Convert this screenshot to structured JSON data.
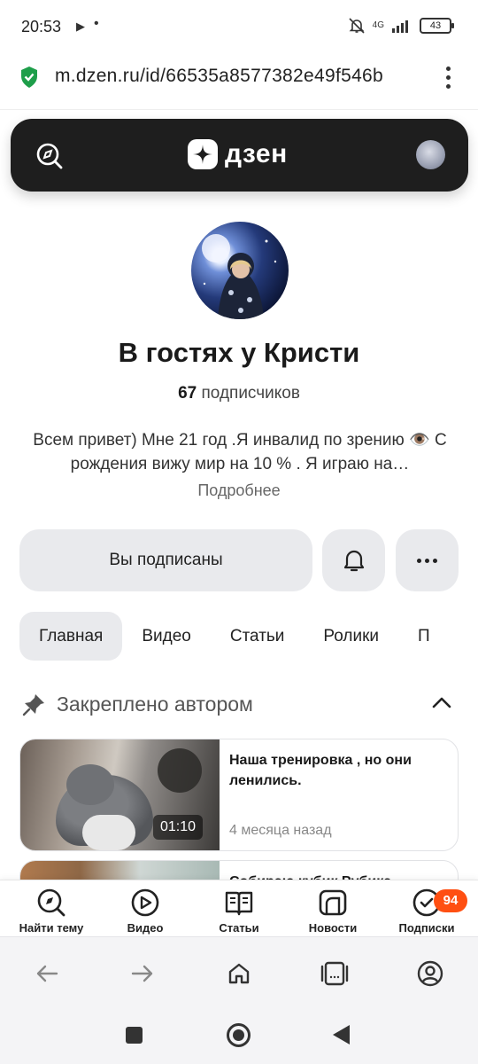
{
  "status_bar": {
    "time": "20:53",
    "network": "4G",
    "battery": "43"
  },
  "browser": {
    "url": "m.dzen.ru/id/66535a8577382e49f546b"
  },
  "header": {
    "logo_text": "дзен"
  },
  "channel": {
    "name": "В гостях у Кристи",
    "subscribers_count": "67",
    "subscribers_label": "подписчиков",
    "description": "Всем привет) Мне 21 год .Я инвалид по зрению 👁️ С рождения вижу мир на 10 % . Я играю на…",
    "more_label": "Подробнее"
  },
  "actions": {
    "subscribed_label": "Вы подписаны"
  },
  "tabs": [
    {
      "label": "Главная",
      "active": true
    },
    {
      "label": "Видео"
    },
    {
      "label": "Статьи"
    },
    {
      "label": "Ролики"
    },
    {
      "label": "П"
    }
  ],
  "pinned": {
    "label": "Закреплено автором",
    "cards": [
      {
        "title": "Наша тренировка , но они ленились.",
        "duration": "01:10",
        "date": "4 месяца назад"
      },
      {
        "title": "Собираю кубик Рубика"
      }
    ]
  },
  "bottom_nav": [
    {
      "label": "Найти тему",
      "icon": "compass-search-icon"
    },
    {
      "label": "Видео",
      "icon": "video-play-icon"
    },
    {
      "label": "Статьи",
      "icon": "book-icon"
    },
    {
      "label": "Новости",
      "icon": "news-icon"
    },
    {
      "label": "Подписки",
      "icon": "subscriptions-icon",
      "badge": "94"
    }
  ],
  "colors": {
    "header_bg": "#1e1e1e",
    "badge": "#ff4f12",
    "shield": "#1e9e4a"
  }
}
